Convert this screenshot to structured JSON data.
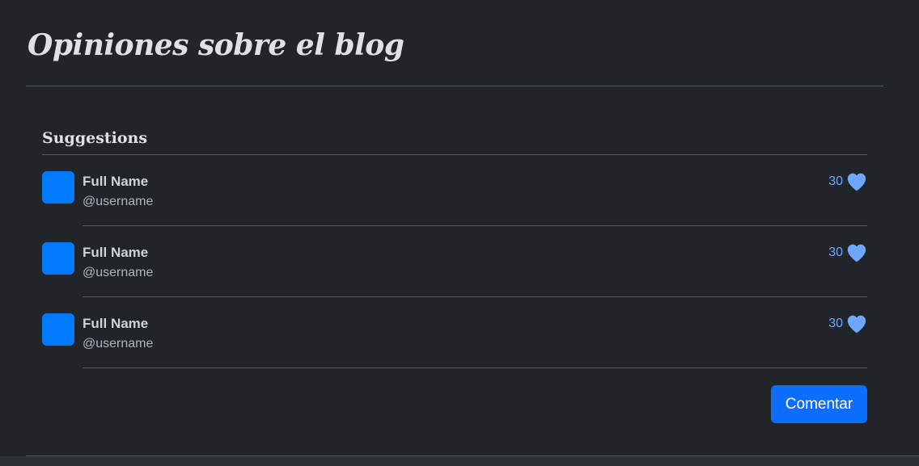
{
  "page": {
    "title": "Opiniones sobre el blog"
  },
  "card": {
    "heading": "Suggestions",
    "items": [
      {
        "full_name": "Full Name",
        "username": "@username",
        "likes": "30",
        "icon": "heart-icon"
      },
      {
        "full_name": "Full Name",
        "username": "@username",
        "likes": "30",
        "icon": "heart-icon"
      },
      {
        "full_name": "Full Name",
        "username": "@username",
        "likes": "30",
        "icon": "heart-icon"
      }
    ],
    "comment_button_label": "Comentar"
  },
  "colors": {
    "background": "#212529",
    "avatar": "#007bff",
    "accent": "#0d6efd",
    "likes": "#6ea8fe",
    "heart": "#6ea8fe"
  }
}
